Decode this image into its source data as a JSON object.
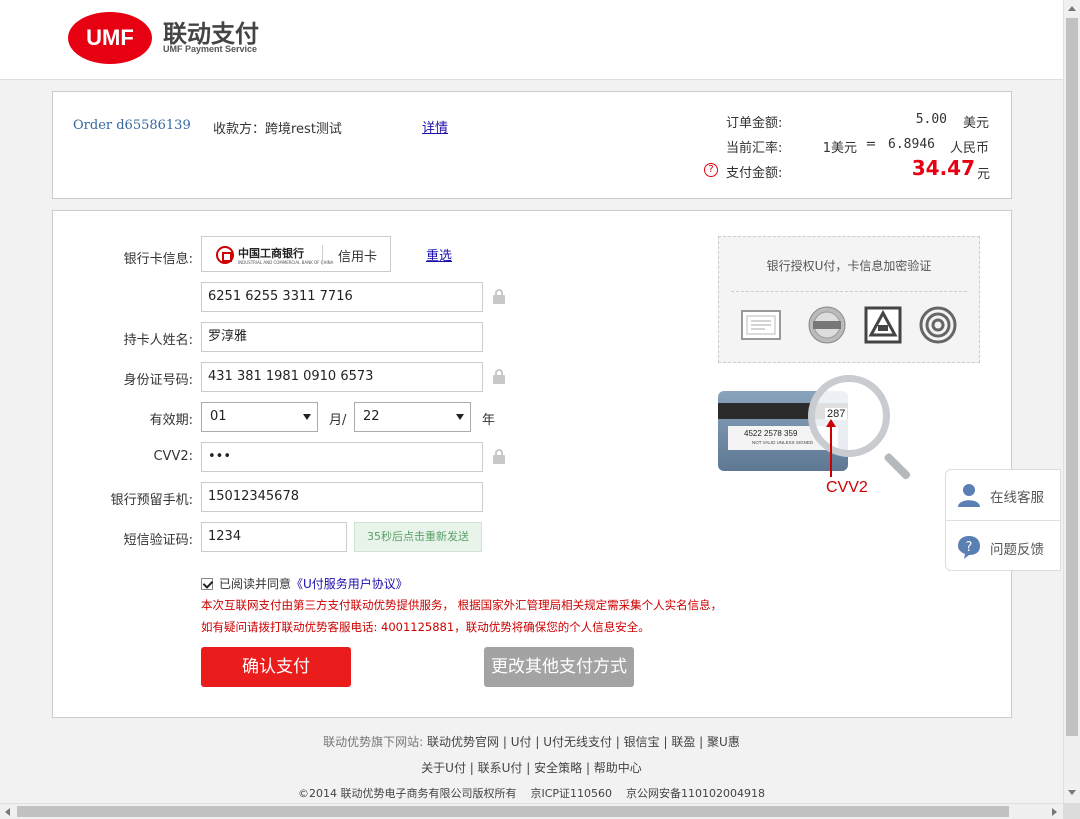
{
  "brand": {
    "logo_text": "UMF",
    "name_cn": "联动支付",
    "name_en": "UMF Payment Service"
  },
  "order": {
    "order_no": "Order d65586139",
    "payee": "收款方：跨境rest测试",
    "detail_link": "详情",
    "amount_label": "订单金额:",
    "amount_value": "5.00",
    "amount_currency": "美元",
    "rate_label": "当前汇率:",
    "rate_from": "1美元",
    "rate_eq": "=",
    "rate_value": "6.8946",
    "rate_currency": "人民币",
    "pay_label": "支付金额:",
    "pay_value": "34.47",
    "pay_unit": "元",
    "help_icon": "?"
  },
  "form": {
    "bank_label": "银行卡信息:",
    "bank_name": "中国工商银行",
    "bank_name_en": "INDUSTRIAL AND COMMERCIAL BANK OF CHINA",
    "card_type": "信用卡",
    "reselect": "重选",
    "card_number": "6251 6255 3311 7716",
    "name_label": "持卡人姓名:",
    "name_value": "罗淳雅",
    "id_label": "身份证号码:",
    "id_value": "431 381 1981 0910 6573",
    "expiry_label": "有效期:",
    "month_value": "01",
    "month_suffix": "月/",
    "year_value": "22",
    "year_suffix": "年",
    "cvv_label": "CVV2:",
    "cvv_value": "•••",
    "phone_label": "银行预留手机:",
    "phone_value": "15012345678",
    "sms_label": "短信验证码:",
    "sms_value": "1234",
    "sms_button": "35秒后点击重新发送",
    "agree_text": "已阅读并同意",
    "agree_link": "《U付服务用户协议》",
    "notice_1": "本次互联网支付由第三方支付联动优势提供服务， 根据国家外汇管理局相关规定需采集个人实名信息，",
    "notice_2": "如有疑问请拨打联动优势客服电话: 4001125881，联动优势将确保您的个人信息安全。",
    "confirm_button": "确认支付",
    "other_button": "更改其他支付方式"
  },
  "verify": {
    "title": "银行授权U付，卡信息加密验证",
    "cvv_caption": "CVV2",
    "card_number_sample": "4522 2578 359",
    "card_sign_text": "NOT VALID UNLESS SIGNED",
    "cvv_sample": "287"
  },
  "float_panel": {
    "service": "在线客服",
    "feedback": "问题反馈"
  },
  "footer": {
    "sites_label": "联动优势旗下网站:",
    "sites": [
      "联动优势官网",
      "U付",
      "U付无线支付",
      "银信宝",
      "联盈",
      "聚U惠"
    ],
    "links": [
      "关于U付",
      "联系U付",
      "安全策略",
      "帮助中心"
    ],
    "copyright": "©2014 联动优势电子商务有限公司版权所有",
    "icp": "京ICP证110560",
    "police": "京公网安备110102004918"
  },
  "colors": {
    "brand_red": "#e60012",
    "accent_red": "#ea1c1c",
    "link_blue": "#1a0dab"
  }
}
